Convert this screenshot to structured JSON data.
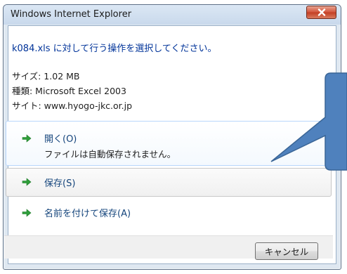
{
  "window": {
    "title": "Windows Internet Explorer"
  },
  "dialog": {
    "instruction": "k084.xls に対して行う操作を選択してください。",
    "size": "サイズ: 1.02 MB",
    "type": "種類: Microsoft Excel 2003",
    "site": "サイト: www.hyogo-jkc.or.jp"
  },
  "commands": [
    {
      "label": "開く(O)",
      "description": "ファイルは自動保存されません。",
      "icon": "green-arrow-icon"
    },
    {
      "label": "保存(S)",
      "icon": "green-arrow-icon"
    },
    {
      "label": "名前を付けて保存(A)",
      "icon": "green-arrow-icon"
    }
  ],
  "footer": {
    "cancel_label": "キャンセル"
  },
  "colors": {
    "accent_text": "#003399",
    "command_text": "#15457c",
    "arrow_green": "#2f9e3a",
    "callout_fill": "#4f81bd"
  }
}
